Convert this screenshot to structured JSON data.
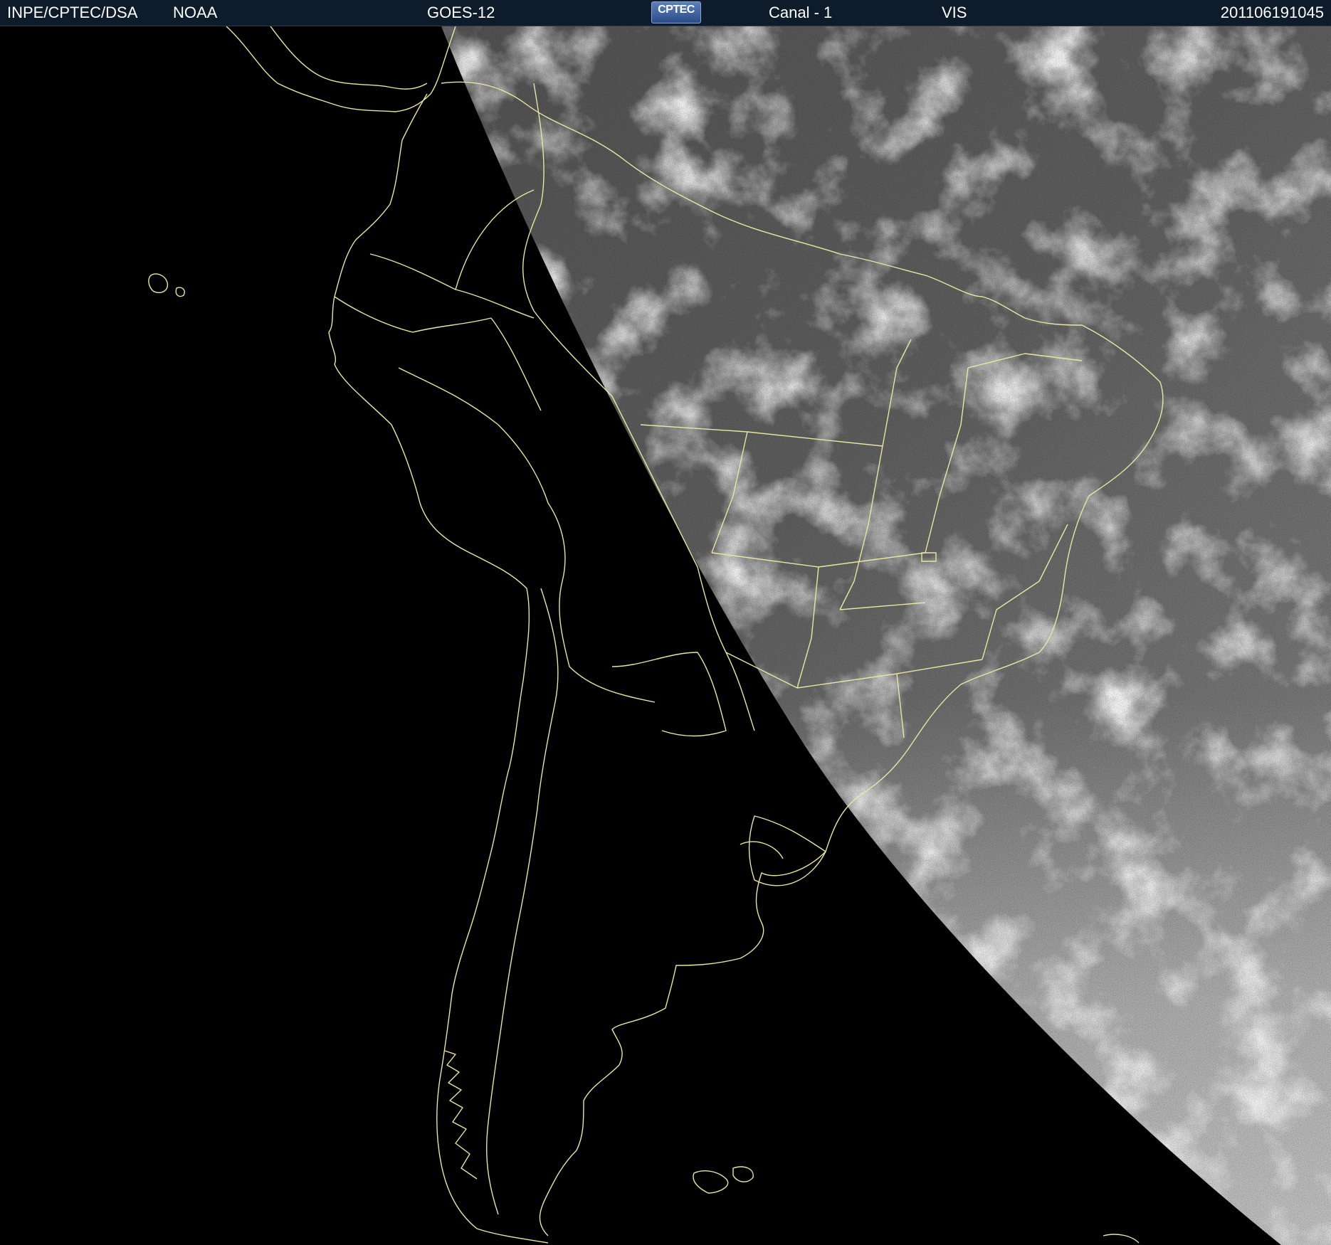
{
  "header": {
    "organization": "INPE/CPTEC/DSA",
    "agency": "NOAA",
    "satellite": "GOES-12",
    "logo_text": "CPTEC",
    "channel": "Canal - 1",
    "band": "VIS",
    "timestamp": "201106191045"
  },
  "map": {
    "border_color": "#e8e6a0",
    "night_color": "#000000",
    "ocean_gray": "#5a5a5a",
    "cloud_color": "#e6e6e6"
  }
}
